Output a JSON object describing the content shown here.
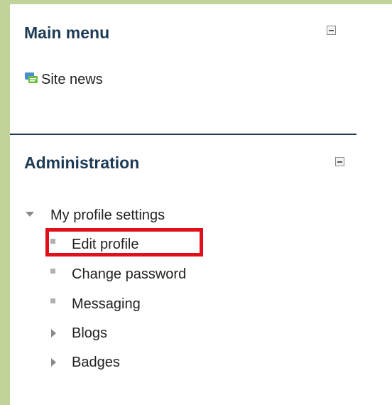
{
  "main_menu": {
    "title": "Main menu",
    "items": [
      {
        "label": "Site news",
        "icon": "forum-news-icon"
      }
    ]
  },
  "administration": {
    "title": "Administration",
    "root": {
      "label": "My profile settings",
      "expanded": true,
      "children": [
        {
          "label": "Edit profile",
          "type": "leaf",
          "highlighted": true
        },
        {
          "label": "Change password",
          "type": "leaf"
        },
        {
          "label": "Messaging",
          "type": "leaf"
        },
        {
          "label": "Blogs",
          "type": "collapsed"
        },
        {
          "label": "Badges",
          "type": "collapsed"
        }
      ]
    }
  },
  "colors": {
    "background": "#c2d39a",
    "title": "#1c3a56",
    "highlight": "#e0101a"
  }
}
